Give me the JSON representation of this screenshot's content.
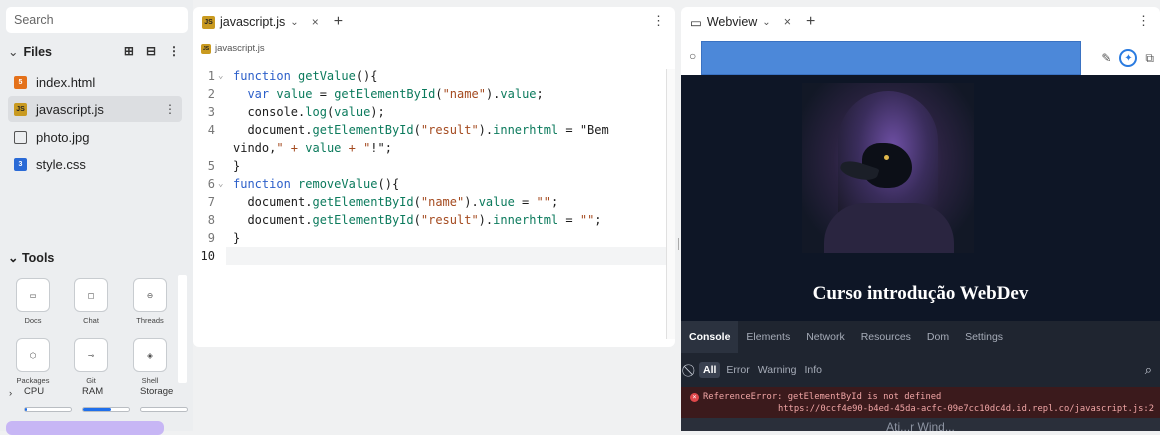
{
  "sidebar": {
    "search_placeholder": "Search",
    "files_title": "Files",
    "files": [
      {
        "name": "index.html",
        "icon": "html-file-icon",
        "active": false
      },
      {
        "name": "javascript.js",
        "icon": "js-file-icon",
        "active": true
      },
      {
        "name": "photo.jpg",
        "icon": "image-file-icon",
        "active": false
      },
      {
        "name": "style.css",
        "icon": "css-file-icon",
        "active": false
      }
    ],
    "tools_title": "Tools",
    "tools": [
      {
        "label": "Docs",
        "icon": "docs-icon"
      },
      {
        "label": "Chat",
        "icon": "chat-icon"
      },
      {
        "label": "Threads",
        "icon": "threads-icon"
      },
      {
        "label": "Packages",
        "icon": "packages-icon"
      },
      {
        "label": "Git",
        "icon": "git-icon"
      },
      {
        "label": "Shell",
        "icon": "shell-icon"
      }
    ],
    "resources": [
      {
        "label": "CPU",
        "level": 0.05
      },
      {
        "label": "RAM",
        "level": 0.6
      },
      {
        "label": "Storage",
        "level": 0.0
      }
    ]
  },
  "editor": {
    "tab_label": "javascript.js",
    "path_label": "javascript.js",
    "lines": [
      {
        "n": "1",
        "fold": true
      },
      {
        "n": "2"
      },
      {
        "n": "3"
      },
      {
        "n": "4"
      },
      {
        "n": ""
      },
      {
        "n": "5"
      },
      {
        "n": "6",
        "fold": true
      },
      {
        "n": "7"
      },
      {
        "n": "8"
      },
      {
        "n": "9"
      },
      {
        "n": "10",
        "current": true
      }
    ],
    "code": [
      "function getValue(){",
      "  var value = getElementById(\"name\").value;",
      "  console.log(value);",
      "  document.getElementById(\"result\").innerhtml = \"Bem",
      "vindo,\" + value + \"!\";",
      "}",
      "function removeValue(){",
      "  document.getElementById(\"name\").value = \"\";",
      "  document.getElementById(\"result\").innerhtml = \"\";",
      "}",
      ""
    ]
  },
  "webview": {
    "tab_label": "Webview",
    "page_title": "Curso introdução WebDev",
    "devtools_tabs": [
      "Console",
      "Elements",
      "Network",
      "Resources",
      "Dom",
      "Settings"
    ],
    "active_devtools_tab": "Console",
    "filters": [
      "All",
      "Error",
      "Warning",
      "Info"
    ],
    "error_message": "ReferenceError: getElementById is not defined",
    "error_source": "https://0ccf4e90-b4ed-45da-acfc-09e7cc10dc4d.id.repl.co/javascript.js:2",
    "footer_text": "Ati...r Wind..."
  }
}
